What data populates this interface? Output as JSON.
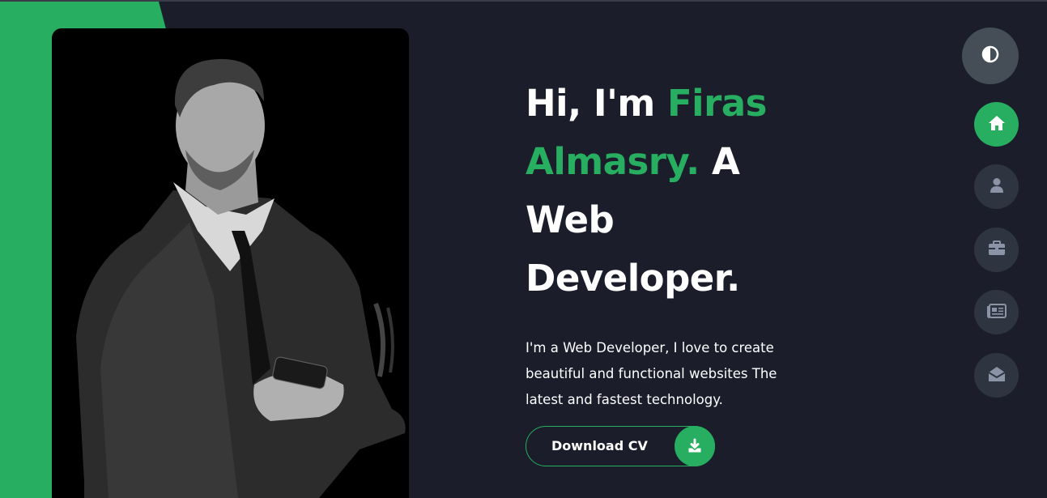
{
  "hero": {
    "greeting": "Hi, I'm ",
    "name_part1": "Firas",
    "name_part2": "Almasry.",
    "title_tail_1": "A",
    "title_tail_2": "Web",
    "title_tail_3": "Developer.",
    "description": "I'm a Web Developer, I love to create beautiful and functional websites The latest and fastest technology.",
    "cta_label": "Download CV",
    "cta_icon": "download-icon"
  },
  "colors": {
    "accent": "#27ae60",
    "background": "#1b1d2b",
    "nav_inactive": "#2f3540",
    "theme_toggle": "#454e56",
    "icon_inactive": "#8a94a6"
  },
  "theme_toggle": {
    "icon": "contrast-icon"
  },
  "nav": [
    {
      "key": "home",
      "icon": "home-icon",
      "active": true
    },
    {
      "key": "about",
      "icon": "user-icon",
      "active": false
    },
    {
      "key": "portfolio",
      "icon": "briefcase-icon",
      "active": false
    },
    {
      "key": "blog",
      "icon": "newspaper-icon",
      "active": false
    },
    {
      "key": "contact",
      "icon": "envelope-open-icon",
      "active": false
    }
  ]
}
